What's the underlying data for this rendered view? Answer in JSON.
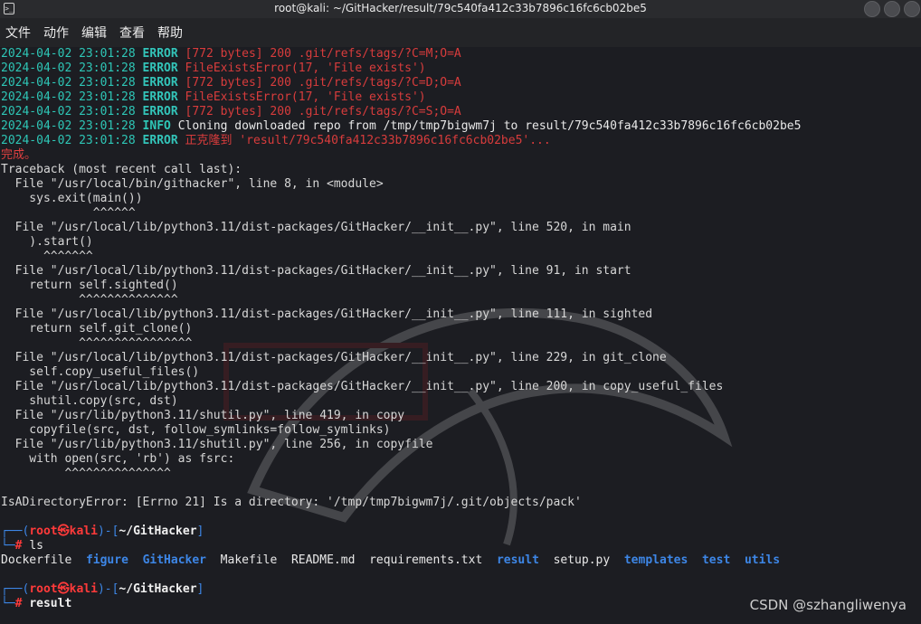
{
  "window": {
    "title": "root@kali: ~/GitHacker/result/79c540fa412c33b7896c16fc6cb02be5",
    "app_icon": "terminal-icon",
    "app_icon_glyph": ">_"
  },
  "menu": [
    "文件",
    "动作",
    "编辑",
    "查看",
    "帮助"
  ],
  "log_lines": [
    {
      "ts": "2024-04-02 23:01:28",
      "level": "ERROR",
      "msg": "[772 bytes] 200 .git/refs/tags/?C=M;O=A",
      "msg_color": "red"
    },
    {
      "ts": "2024-04-02 23:01:28",
      "level": "ERROR",
      "msg": "FileExistsError(17, 'File exists')",
      "msg_color": "red"
    },
    {
      "ts": "2024-04-02 23:01:28",
      "level": "ERROR",
      "msg": "[772 bytes] 200 .git/refs/tags/?C=D;O=A",
      "msg_color": "red"
    },
    {
      "ts": "2024-04-02 23:01:28",
      "level": "ERROR",
      "msg": "FileExistsError(17, 'File exists')",
      "msg_color": "red"
    },
    {
      "ts": "2024-04-02 23:01:28",
      "level": "ERROR",
      "msg": "[772 bytes] 200 .git/refs/tags/?C=S;O=A",
      "msg_color": "red"
    },
    {
      "ts": "2024-04-02 23:01:28",
      "level": "INFO",
      "msg": "Cloning downloaded repo from /tmp/tmp7bigwm7j to result/79c540fa412c33b7896c16fc6cb02be5",
      "msg_color": "white"
    },
    {
      "ts": "2024-04-02 23:01:28",
      "level": "ERROR",
      "msg": "正克隆到 'result/79c540fa412c33b7896c16fc6cb02be5'...",
      "msg_color": "red"
    }
  ],
  "done_text": "完成。",
  "traceback": [
    "Traceback (most recent call last):",
    "  File \"/usr/local/bin/githacker\", line 8, in <module>",
    "    sys.exit(main())",
    "             ^^^^^^",
    "  File \"/usr/local/lib/python3.11/dist-packages/GitHacker/__init__.py\", line 520, in main",
    "    ).start()",
    "      ^^^^^^^",
    "  File \"/usr/local/lib/python3.11/dist-packages/GitHacker/__init__.py\", line 91, in start",
    "    return self.sighted()",
    "           ^^^^^^^^^^^^^^",
    "  File \"/usr/local/lib/python3.11/dist-packages/GitHacker/__init__.py\", line 111, in sighted",
    "    return self.git_clone()",
    "           ^^^^^^^^^^^^^^^^",
    "  File \"/usr/local/lib/python3.11/dist-packages/GitHacker/__init__.py\", line 229, in git_clone",
    "    self.copy_useful_files()",
    "  File \"/usr/local/lib/python3.11/dist-packages/GitHacker/__init__.py\", line 200, in copy_useful_files",
    "    shutil.copy(src, dst)",
    "  File \"/usr/lib/python3.11/shutil.py\", line 419, in copy",
    "    copyfile(src, dst, follow_symlinks=follow_symlinks)",
    "  File \"/usr/lib/python3.11/shutil.py\", line 256, in copyfile",
    "    with open(src, 'rb') as fsrc:",
    "         ^^^^^^^^^^^^^^^",
    "",
    "IsADirectoryError: [Errno 21] Is a directory: '/tmp/tmp7bigwm7j/.git/objects/pack'",
    ""
  ],
  "prompts": [
    {
      "user": "root",
      "at": "㉿",
      "host": "kali",
      "path": "~/GitHacker",
      "command": "ls"
    },
    {
      "user": "root",
      "at": "㉿",
      "host": "kali",
      "path": "~/GitHacker",
      "command": "result"
    }
  ],
  "ls_output": [
    {
      "name": "Dockerfile",
      "type": "file"
    },
    {
      "name": "figure",
      "type": "dir"
    },
    {
      "name": "GitHacker",
      "type": "dir"
    },
    {
      "name": "Makefile",
      "type": "file"
    },
    {
      "name": "README.md",
      "type": "file"
    },
    {
      "name": "requirements.txt",
      "type": "file"
    },
    {
      "name": "result",
      "type": "dir"
    },
    {
      "name": "setup.py",
      "type": "file"
    },
    {
      "name": "templates",
      "type": "dir"
    },
    {
      "name": "test",
      "type": "dir"
    },
    {
      "name": "utils",
      "type": "dir"
    }
  ],
  "watermark": "CSDN @szhangliwenya",
  "colors": {
    "terminal_bg": "#1c1d22",
    "teal": "#2ec6b6",
    "error_red": "#d83c3c",
    "dir_blue": "#3d86e6"
  }
}
